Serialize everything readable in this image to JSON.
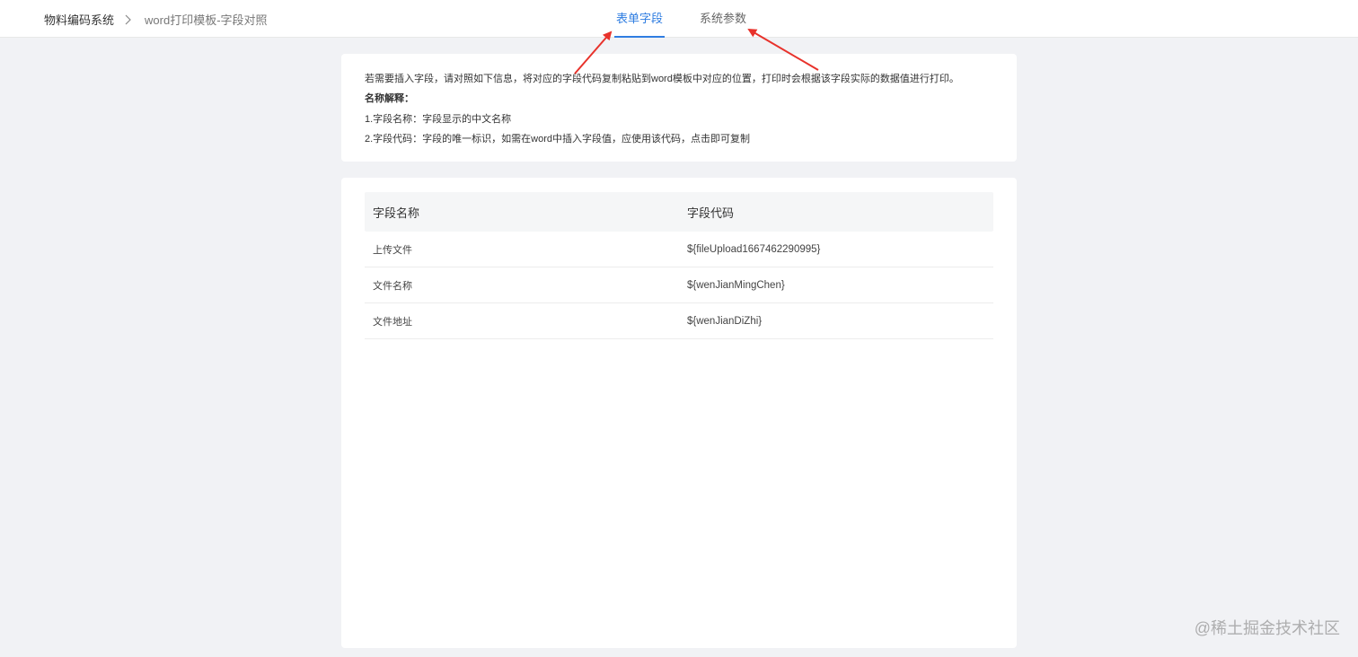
{
  "breadcrumb": {
    "root": "物料编码系统",
    "current": "word打印模板-字段对照"
  },
  "tabs": [
    {
      "label": "表单字段",
      "active": true
    },
    {
      "label": "系统参数",
      "active": false
    }
  ],
  "info": {
    "line1": "若需要插入字段，请对照如下信息，将对应的字段代码复制粘贴到word模板中对应的位置，打印时会根据该字段实际的数据值进行打印。",
    "heading": "名称解释：",
    "line2": "1.字段名称：字段显示的中文名称",
    "line3": "2.字段代码：字段的唯一标识，如需在word中插入字段值，应使用该代码，点击即可复制"
  },
  "table": {
    "headers": [
      "字段名称",
      "字段代码"
    ],
    "rows": [
      {
        "name": "上传文件",
        "code": "${fileUpload1667462290995}"
      },
      {
        "name": "文件名称",
        "code": "${wenJianMingChen}"
      },
      {
        "name": "文件地址",
        "code": "${wenJianDiZhi}"
      }
    ]
  },
  "watermark": "@稀土掘金技术社区",
  "colors": {
    "accent": "#2f7de1",
    "annotation_arrow": "#e8322b",
    "page_bg": "#f1f2f5"
  },
  "icons": {
    "breadcrumb_separator": "chevron-right-icon"
  }
}
